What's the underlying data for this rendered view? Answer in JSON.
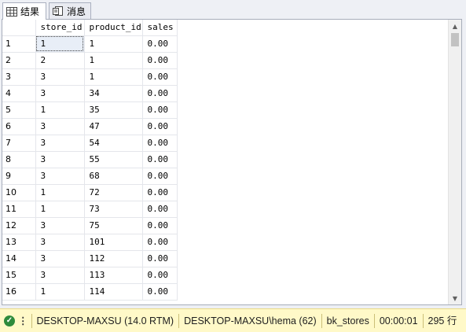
{
  "tabs": [
    {
      "label": "结果",
      "icon": "grid-icon",
      "active": true
    },
    {
      "label": "消息",
      "icon": "message-icon",
      "active": false
    }
  ],
  "grid": {
    "columns": [
      "store_id",
      "product_id",
      "sales"
    ],
    "rows": [
      {
        "n": "1",
        "store_id": "1",
        "product_id": "1",
        "sales": "0.00"
      },
      {
        "n": "2",
        "store_id": "2",
        "product_id": "1",
        "sales": "0.00"
      },
      {
        "n": "3",
        "store_id": "3",
        "product_id": "1",
        "sales": "0.00"
      },
      {
        "n": "4",
        "store_id": "3",
        "product_id": "34",
        "sales": "0.00"
      },
      {
        "n": "5",
        "store_id": "1",
        "product_id": "35",
        "sales": "0.00"
      },
      {
        "n": "6",
        "store_id": "3",
        "product_id": "47",
        "sales": "0.00"
      },
      {
        "n": "7",
        "store_id": "3",
        "product_id": "54",
        "sales": "0.00"
      },
      {
        "n": "8",
        "store_id": "3",
        "product_id": "55",
        "sales": "0.00"
      },
      {
        "n": "9",
        "store_id": "3",
        "product_id": "68",
        "sales": "0.00"
      },
      {
        "n": "10",
        "store_id": "1",
        "product_id": "72",
        "sales": "0.00"
      },
      {
        "n": "11",
        "store_id": "1",
        "product_id": "73",
        "sales": "0.00"
      },
      {
        "n": "12",
        "store_id": "3",
        "product_id": "75",
        "sales": "0.00"
      },
      {
        "n": "13",
        "store_id": "3",
        "product_id": "101",
        "sales": "0.00"
      },
      {
        "n": "14",
        "store_id": "3",
        "product_id": "112",
        "sales": "0.00"
      },
      {
        "n": "15",
        "store_id": "3",
        "product_id": "113",
        "sales": "0.00"
      },
      {
        "n": "16",
        "store_id": "1",
        "product_id": "114",
        "sales": "0.00"
      }
    ]
  },
  "status": {
    "server": "DESKTOP-MAXSU (14.0 RTM)",
    "user": "DESKTOP-MAXSU\\hema (62)",
    "database": "bk_stores",
    "elapsed": "00:00:01",
    "rowcount": "295 行",
    "icon": "success-check-icon",
    "color": "#fff9c8"
  }
}
